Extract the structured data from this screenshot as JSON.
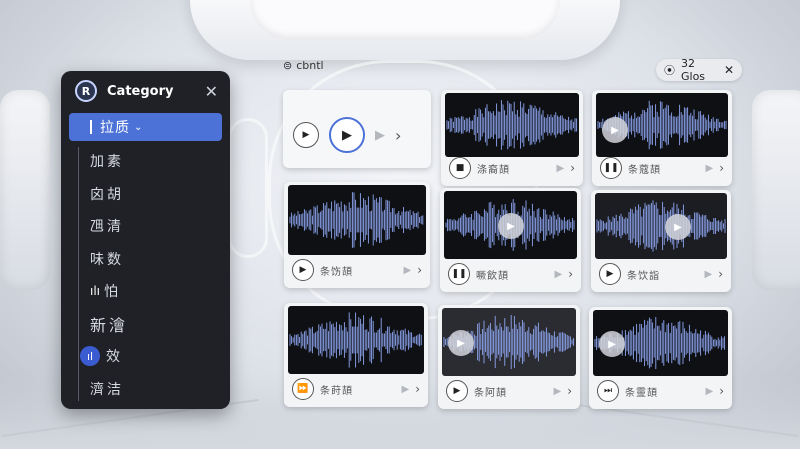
{
  "header": {
    "label": "cbntl",
    "filter_label": "32 Glos"
  },
  "sidebar": {
    "logo": "R",
    "title": "Category",
    "items": [
      {
        "label": "拉质"
      },
      {
        "label": "加素"
      },
      {
        "label": "囟胡"
      },
      {
        "label": "乪清"
      },
      {
        "label": "味数"
      },
      {
        "label": "怕"
      },
      {
        "label": "新澮"
      },
      {
        "label": "效"
      },
      {
        "label": "濟洁"
      }
    ]
  },
  "cards": [
    {
      "label": ""
    },
    {
      "label": "涤裔頡"
    },
    {
      "label": "条蔻頡"
    },
    {
      "label": "条饬頡"
    },
    {
      "label": "噘飲頡"
    },
    {
      "label": "条饮詣"
    },
    {
      "label": "条莳頡"
    },
    {
      "label": "条阿頡"
    },
    {
      "label": "条靈頡"
    }
  ],
  "colors": {
    "accent": "#4c72d8",
    "wave": "#8fa6f2",
    "panel": "#1f2126"
  }
}
